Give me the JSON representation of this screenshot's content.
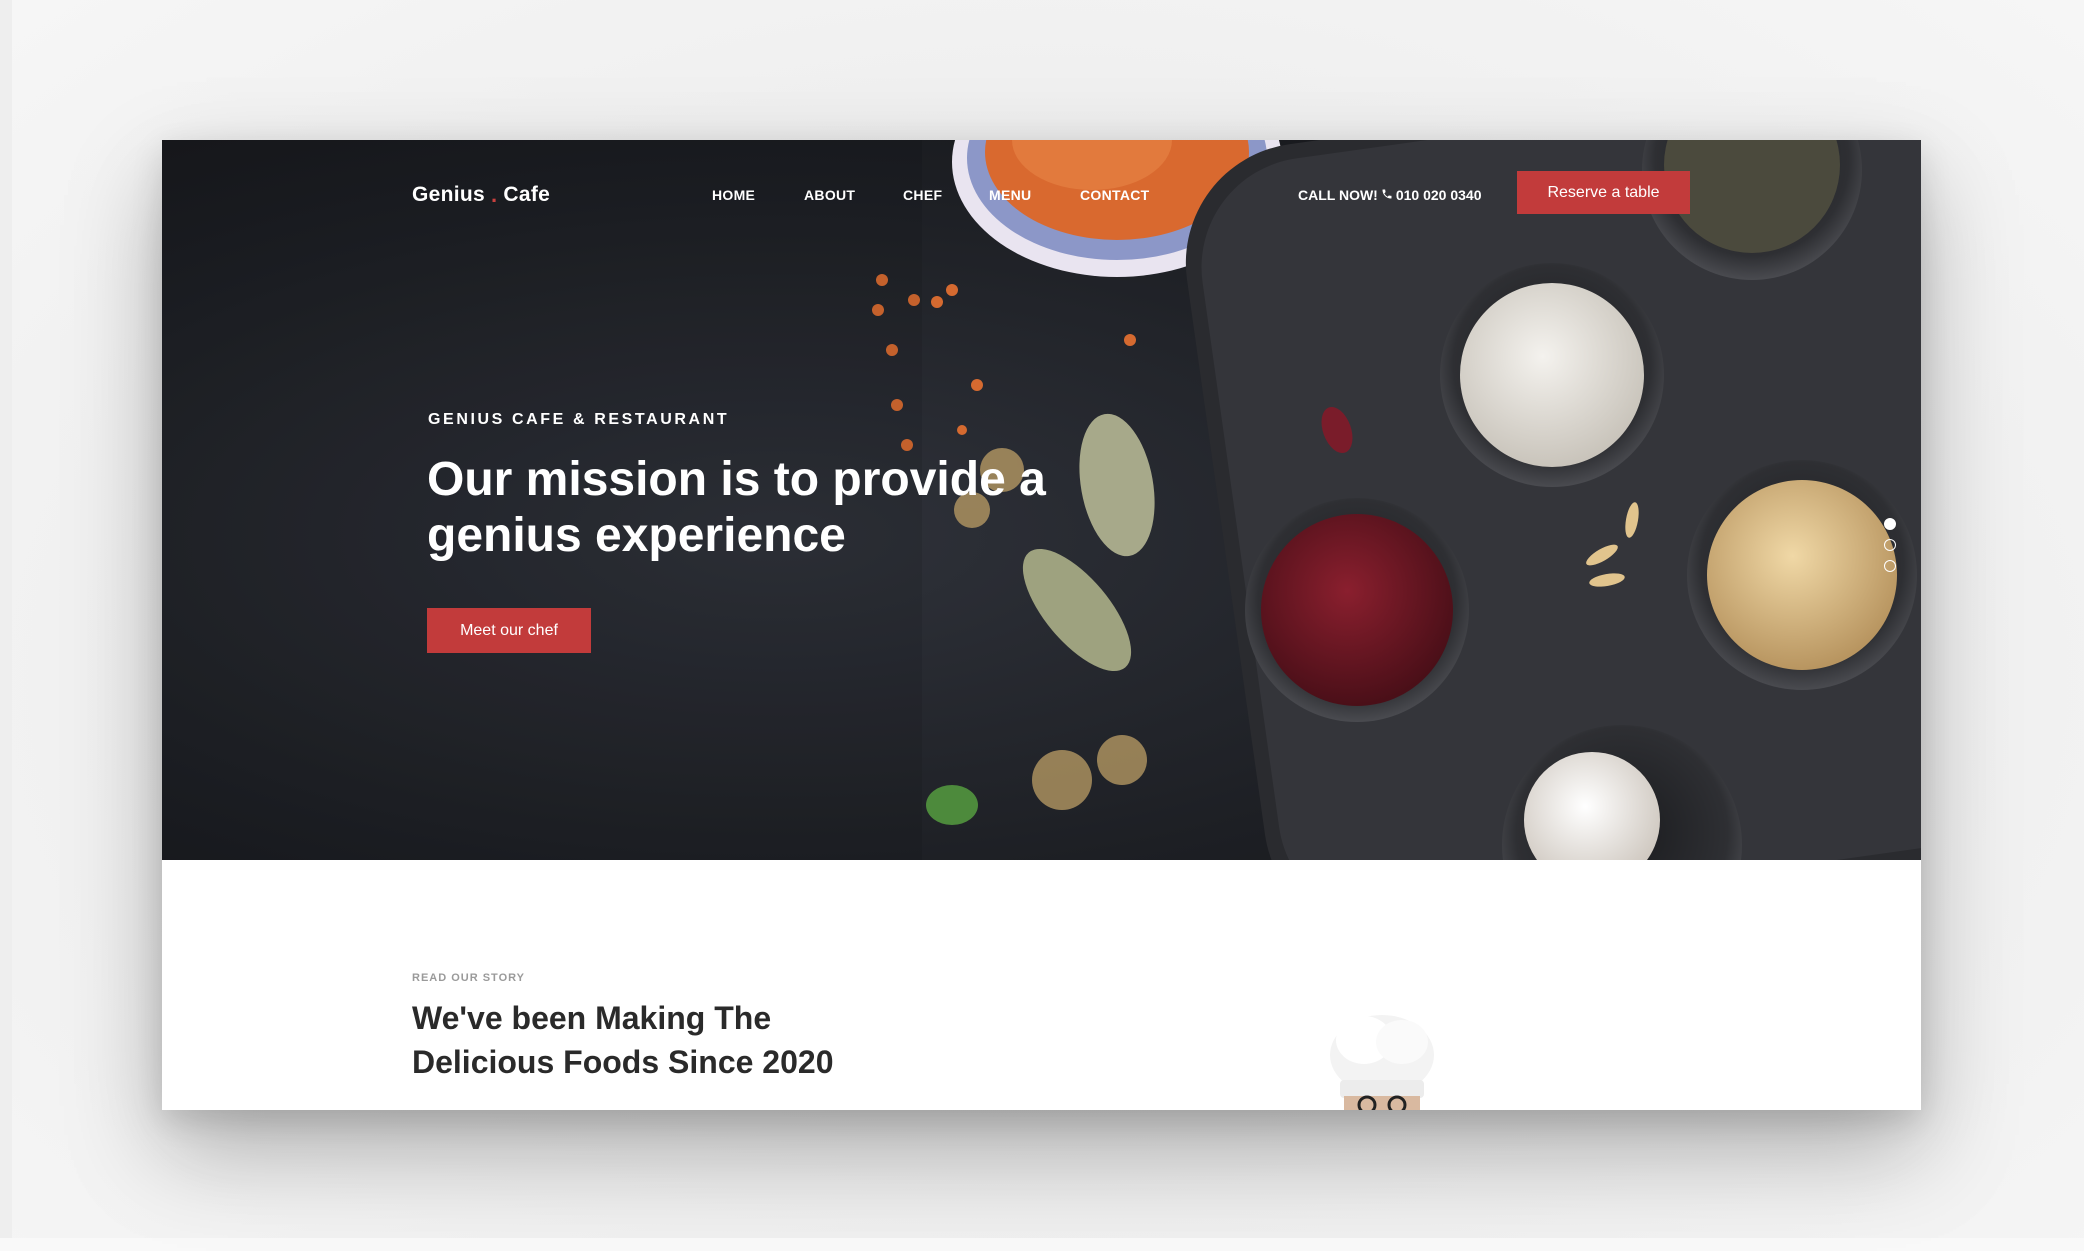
{
  "brand": {
    "name_part1": "Genius",
    "dot": ".",
    "name_part2": "Cafe",
    "accent_color": "#c23b3b"
  },
  "nav": {
    "items": [
      {
        "label": "HOME"
      },
      {
        "label": "ABOUT"
      },
      {
        "label": "CHEF"
      },
      {
        "label": "MENU"
      },
      {
        "label": "CONTACT"
      }
    ],
    "call_label": "CALL NOW!",
    "phone": "010 020 0340",
    "phone_icon": "phone-icon",
    "reserve_label": "Reserve a table"
  },
  "hero": {
    "eyebrow": "GENIUS CAFE & RESTAURANT",
    "title_line1": "Our mission is to provide a",
    "title_line2": "genius experience",
    "cta_label": "Meet our chef",
    "slides_total": 3,
    "active_slide": 1
  },
  "story": {
    "eyebrow": "READ OUR STORY",
    "title_line1": "We've been Making The",
    "title_line2": "Delicious Foods Since 2020"
  }
}
